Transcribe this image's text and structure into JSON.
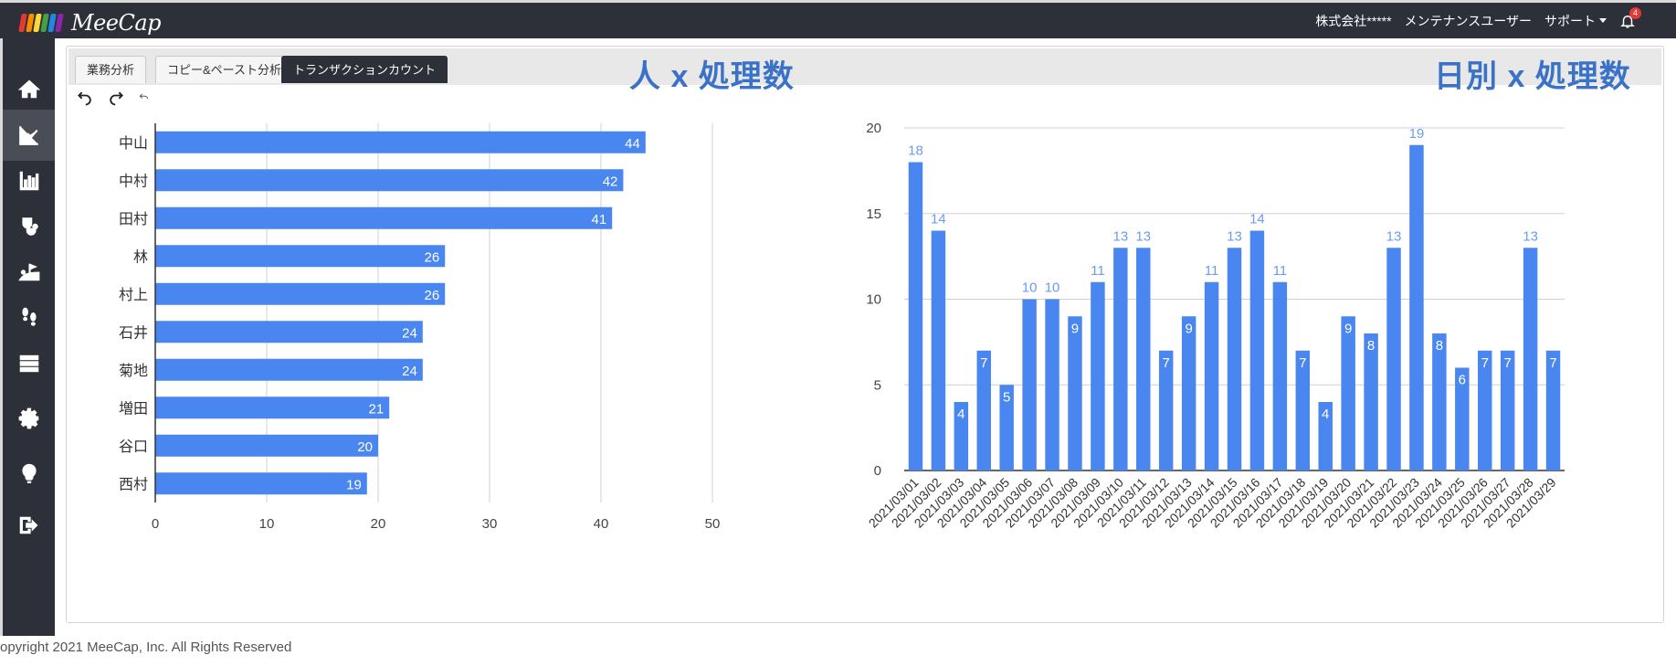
{
  "app": {
    "logo_text": "MeeCap",
    "logo_colors": [
      "#e53935",
      "#fb8c00",
      "#fdd835",
      "#43a047",
      "#1e88e5",
      "#8e24aa"
    ],
    "company": "株式会社*****",
    "user": "メンテナンスユーザー",
    "support": "サポート",
    "notification_count": "4"
  },
  "sidebar": {
    "items": [
      {
        "name": "home",
        "icon": "home-icon",
        "active": false
      },
      {
        "name": "analytics",
        "icon": "trend-chart-icon",
        "active": true
      },
      {
        "name": "bar-stats",
        "icon": "bar-chart-icon",
        "active": false
      },
      {
        "name": "diagnosis",
        "icon": "stethoscope-icon",
        "active": false
      },
      {
        "name": "improvement",
        "icon": "flag-hill-icon",
        "active": false
      },
      {
        "name": "footsteps",
        "icon": "footsteps-icon",
        "active": false
      },
      {
        "name": "servers",
        "icon": "server-list-icon",
        "active": false
      },
      {
        "name": "settings",
        "icon": "gear-icon",
        "active": false
      },
      {
        "name": "ideas",
        "icon": "lightbulb-icon",
        "active": false
      },
      {
        "name": "logout",
        "icon": "logout-icon",
        "active": false
      }
    ]
  },
  "tabs": [
    {
      "label": "業務分析",
      "active": false
    },
    {
      "label": "コピー&ペースト分析",
      "active": false
    },
    {
      "label": "トランザクションカウント",
      "active": true
    }
  ],
  "headlines": {
    "left": "人 x 処理数",
    "right": "日別 x 処理数"
  },
  "toolbar": [
    "undo-icon",
    "redo-icon",
    "small-undo-icon"
  ],
  "colors": {
    "bar": "#4a86ef",
    "dark": "#2d3038",
    "headline": "#3a72c7",
    "label_above": "#6a9df0"
  },
  "chart_data": [
    {
      "type": "bar",
      "orientation": "horizontal",
      "categories": [
        "中山",
        "中村",
        "田村",
        "林",
        "村上",
        "石井",
        "菊地",
        "増田",
        "谷口",
        "西村"
      ],
      "values": [
        44,
        42,
        41,
        26,
        26,
        24,
        24,
        21,
        20,
        19
      ],
      "xlim": [
        0,
        50
      ],
      "xticks": [
        0,
        10,
        20,
        30,
        40,
        50
      ],
      "grid": true,
      "data_labels": "inside-end"
    },
    {
      "type": "bar",
      "orientation": "vertical",
      "categories": [
        "2021/03/01",
        "2021/03/02",
        "2021/03/03",
        "2021/03/04",
        "2021/03/05",
        "2021/03/06",
        "2021/03/07",
        "2021/03/08",
        "2021/03/09",
        "2021/03/10",
        "2021/03/11",
        "2021/03/12",
        "2021/03/13",
        "2021/03/14",
        "2021/03/15",
        "2021/03/16",
        "2021/03/17",
        "2021/03/18",
        "2021/03/19",
        "2021/03/20",
        "2021/03/21",
        "2021/03/22",
        "2021/03/23",
        "2021/03/24",
        "2021/03/25",
        "2021/03/26",
        "2021/03/27",
        "2021/03/28",
        "2021/03/29"
      ],
      "values": [
        18,
        14,
        4,
        7,
        5,
        10,
        10,
        9,
        11,
        13,
        13,
        7,
        9,
        11,
        13,
        14,
        11,
        7,
        4,
        9,
        8,
        13,
        19,
        8,
        6,
        7,
        7,
        13,
        7
      ],
      "ylim": [
        0,
        20
      ],
      "yticks": [
        0,
        5,
        10,
        15,
        20
      ],
      "grid": true,
      "data_labels": "above-or-inside"
    }
  ],
  "footer": "opyright 2021 MeeCap, Inc. All Rights Reserved"
}
